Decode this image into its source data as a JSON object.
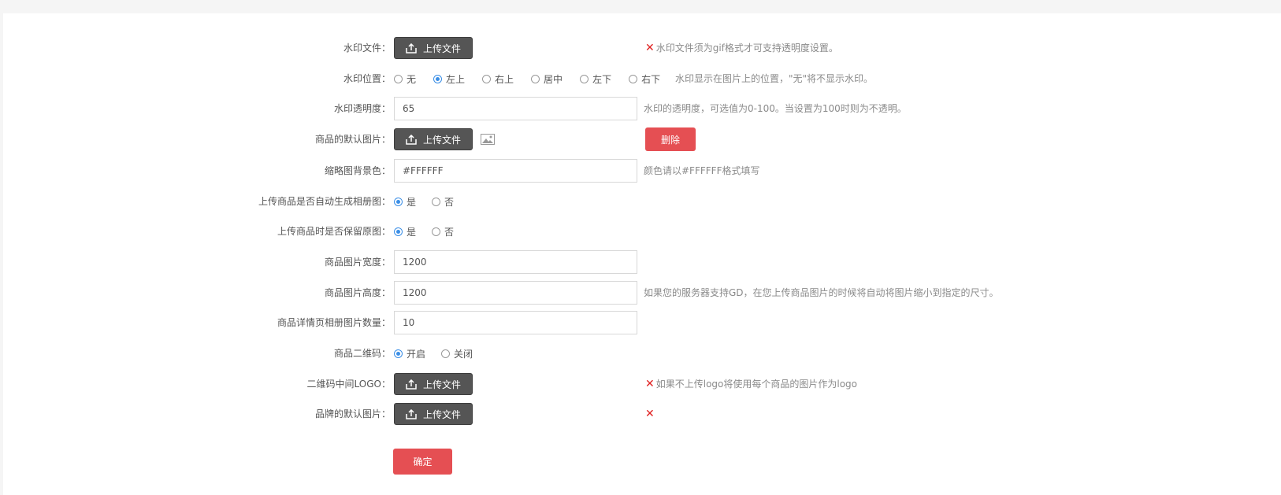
{
  "form": {
    "watermark_file": {
      "label": "水印文件：",
      "button": "上传文件",
      "hint": "水印文件须为gif格式才可支持透明度设置。",
      "hint_icon": "close-icon"
    },
    "watermark_position": {
      "label": "水印位置：",
      "options": [
        "无",
        "左上",
        "右上",
        "居中",
        "左下",
        "右下"
      ],
      "selected": "左上",
      "hint": "水印显示在图片上的位置，\"无\"将不显示水印。"
    },
    "watermark_opacity": {
      "label": "水印透明度：",
      "value": "65",
      "hint": "水印的透明度，可选值为0-100。当设置为100时则为不透明。"
    },
    "default_goods_image": {
      "label": "商品的默认图片：",
      "button": "上传文件",
      "image_icon": "image-icon",
      "delete_button": "删除"
    },
    "thumb_bg_color": {
      "label": "缩略图背景色：",
      "value": "#FFFFFF",
      "hint": "颜色请以#FFFFFF格式填写"
    },
    "auto_gallery": {
      "label": "上传商品是否自动生成相册图：",
      "options": [
        "是",
        "否"
      ],
      "selected": "是"
    },
    "keep_original": {
      "label": "上传商品时是否保留原图：",
      "options": [
        "是",
        "否"
      ],
      "selected": "是"
    },
    "image_width": {
      "label": "商品图片宽度：",
      "value": "1200"
    },
    "image_height": {
      "label": "商品图片高度：",
      "value": "1200",
      "hint": "如果您的服务器支持GD，在您上传商品图片的时候将自动将图片缩小到指定的尺寸。"
    },
    "gallery_count": {
      "label": "商品详情页相册图片数量：",
      "value": "10"
    },
    "qrcode": {
      "label": "商品二维码：",
      "options": [
        "开启",
        "关闭"
      ],
      "selected": "开启"
    },
    "qrcode_logo": {
      "label": "二维码中间LOGO：",
      "button": "上传文件",
      "hint": "如果不上传logo将使用每个商品的图片作为logo",
      "hint_icon": "close-icon"
    },
    "brand_default_image": {
      "label": "品牌的默认图片：",
      "button": "上传文件",
      "hint_icon": "close-icon"
    },
    "submit_label": "确定"
  },
  "colors": {
    "accent_red": "#e54f53",
    "radio_blue": "#3a8ee6",
    "upload_dark": "#555555",
    "error_red": "#e02020"
  }
}
